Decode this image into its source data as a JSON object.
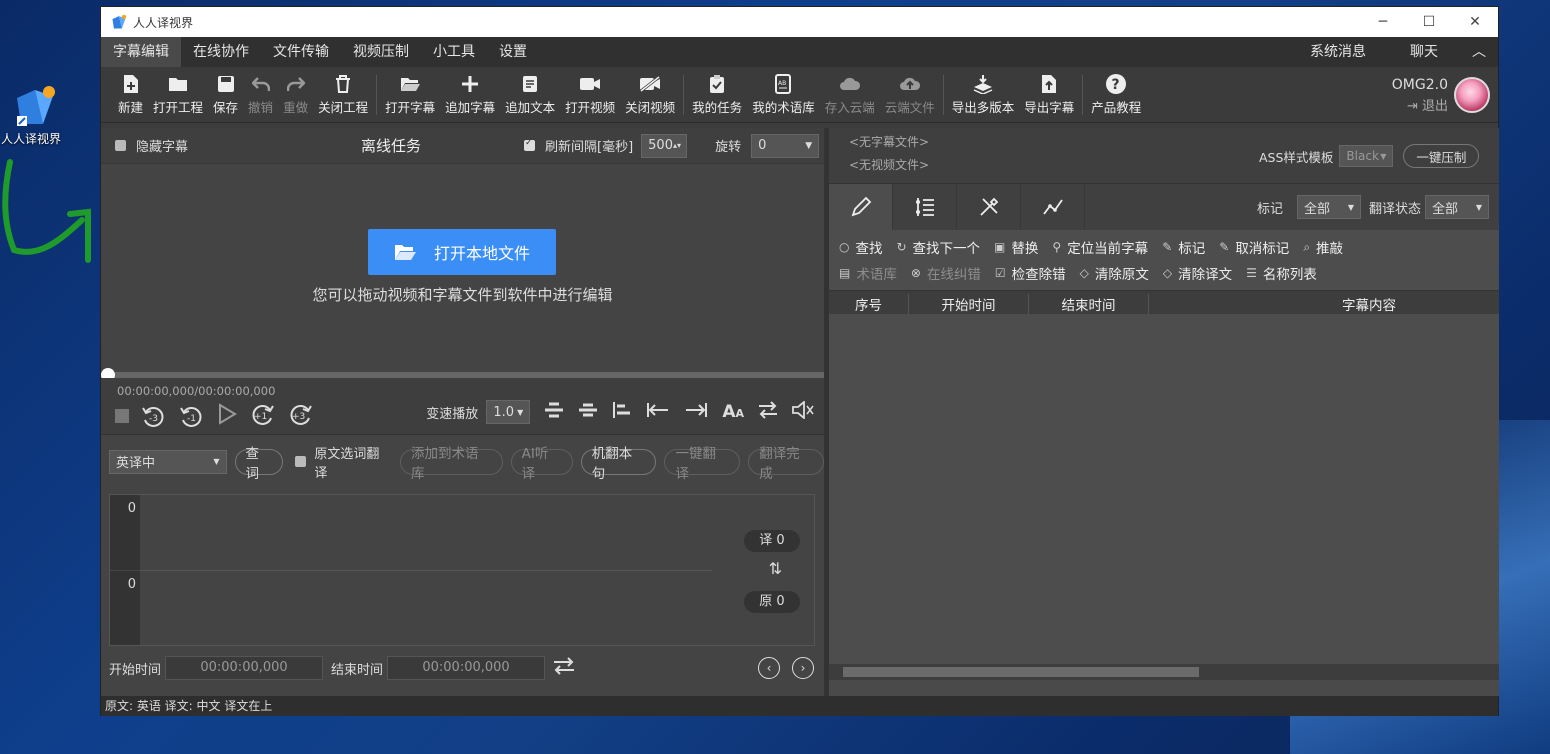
{
  "desktop": {
    "icon_label": "人人译视界"
  },
  "window": {
    "title": "人人译视界"
  },
  "menu": {
    "items": [
      "字幕编辑",
      "在线协作",
      "文件传输",
      "视频压制",
      "小工具",
      "设置"
    ],
    "right": [
      "系统消息",
      "聊天"
    ]
  },
  "toolbar": {
    "new": "新建",
    "open_project": "打开工程",
    "save": "保存",
    "undo": "撤销",
    "redo": "重做",
    "close_project": "关闭工程",
    "open_subtitle": "打开字幕",
    "add_subtitle": "追加字幕",
    "add_text": "追加文本",
    "open_video": "打开视频",
    "close_video": "关闭视频",
    "my_tasks": "我的任务",
    "my_terms": "我的术语库",
    "save_cloud": "存入云端",
    "cloud_files": "云端文件",
    "export_multi": "导出多版本",
    "export_subtitle": "导出字幕",
    "tutorial": "产品教程"
  },
  "user": {
    "name": "OMG2.0",
    "logout": "退出"
  },
  "left": {
    "hide_subtitle": "隐藏字幕",
    "offline_task": "离线任务",
    "refresh_label": "刷新间隔[毫秒]",
    "refresh_value": "500",
    "rotate_label": "旋转",
    "rotate_value": "0",
    "open_local": "打开本地文件",
    "drag_hint": "您可以拖动视频和字幕文件到软件中进行编辑",
    "time_display": "00:00:00,000/00:00:00,000",
    "back3": "-3",
    "back1": "-1",
    "fwd1": "+1",
    "fwd3": "+3",
    "speed_label": "变速播放",
    "speed_value": "1.0",
    "lang_value": "英译中",
    "lookup": "查词",
    "select_translate": "原文选词翻译",
    "add_term": "添加到术语库",
    "ai_listen": "AI听译",
    "machine_translate": "机翻本句",
    "one_key_translate": "一键翻译",
    "translate_done": "翻译完成",
    "gutter_top": "0",
    "gutter_bottom": "0",
    "badge_trans": "译 0",
    "badge_orig": "原 0",
    "start_label": "开始时间",
    "start_value": "00:00:00,000",
    "end_label": "结束时间",
    "end_value": "00:00:00,000"
  },
  "right": {
    "no_sub_file": "<无字幕文件>",
    "no_video_file": "<无视频文件>",
    "ass_label": "ASS样式模板",
    "ass_value": "Black",
    "one_key_burn": "一键压制",
    "mark_label": "标记",
    "mark_value": "全部",
    "trans_state_label": "翻译状态",
    "trans_state_value": "全部",
    "tools_row1": [
      "查找",
      "查找下一个",
      "替换",
      "定位当前字幕",
      "标记",
      "取消标记",
      "推敲"
    ],
    "tools_row2": [
      "术语库",
      "在线纠错",
      "检查除错",
      "清除原文",
      "清除译文",
      "名称列表"
    ],
    "columns": [
      "序号",
      "开始时间",
      "结束时间",
      "字幕内容"
    ]
  },
  "status": {
    "text": "原文: 英语 译文: 中文   译文在上"
  }
}
